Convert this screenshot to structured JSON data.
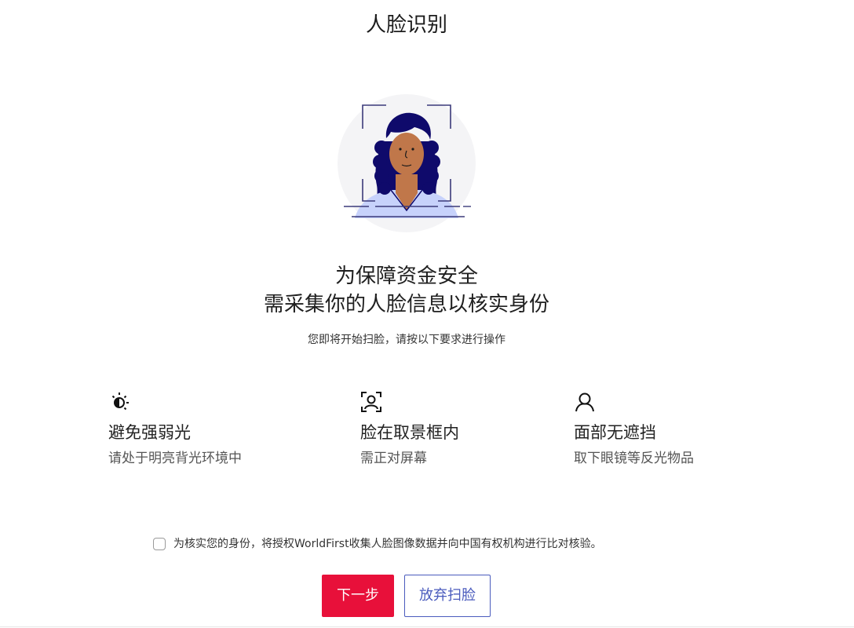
{
  "page": {
    "title": "人脸识别"
  },
  "hero": {
    "line1": "为保障资金安全",
    "line2": "需采集你的人脸信息以核实身份",
    "subtext": "您即将开始扫脸，请按以下要求进行操作"
  },
  "tips": [
    {
      "icon": "light-icon",
      "title": "避免强弱光",
      "desc": "请处于明亮背光环境中"
    },
    {
      "icon": "face-frame-icon",
      "title": "脸在取景框内",
      "desc": "需正对屏幕"
    },
    {
      "icon": "person-icon",
      "title": "面部无遮挡",
      "desc": "取下眼镜等反光物品"
    }
  ],
  "consent": {
    "text": "为核实您的身份，将授权WorldFirst收集人脸图像数据并向中国有权机构进行比对核验。",
    "checked": false
  },
  "buttons": {
    "next": "下一步",
    "abandon": "放弃扫脸"
  },
  "colors": {
    "primary": "#e8103a",
    "secondary": "#4a5bbd",
    "hair": "#0f0a6b",
    "skin": "#c0774a",
    "shirt": "#c7d2fb",
    "frame": "#3b3a7a"
  }
}
